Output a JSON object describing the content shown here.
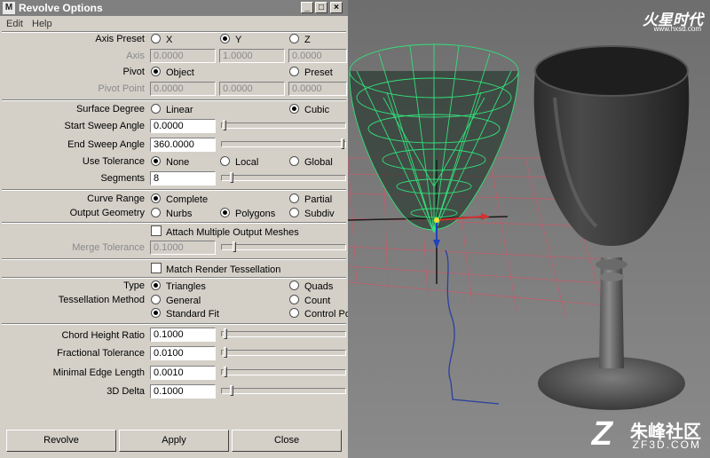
{
  "window": {
    "title": "Revolve Options",
    "min": "_",
    "max": "□",
    "close": "×"
  },
  "menu": [
    "Edit",
    "Help"
  ],
  "axis_preset": {
    "label": "Axis Preset",
    "options": [
      "X",
      "Y",
      "Z"
    ],
    "selected": "Y"
  },
  "axis": {
    "label": "Axis",
    "values": [
      "0.0000",
      "1.0000",
      "0.0000"
    ]
  },
  "pivot": {
    "label": "Pivot",
    "options": [
      "Object",
      "Preset"
    ],
    "selected": "Object"
  },
  "pivot_point": {
    "label": "Pivot Point",
    "values": [
      "0.0000",
      "0.0000",
      "0.0000"
    ]
  },
  "surface_degree": {
    "label": "Surface Degree",
    "options": [
      "Linear",
      "Cubic"
    ],
    "selected": "Cubic"
  },
  "start_sweep": {
    "label": "Start Sweep Angle",
    "value": "0.0000",
    "slider_fraction": 0.0
  },
  "end_sweep": {
    "label": "End Sweep Angle",
    "value": "360.0000",
    "slider_fraction": 1.0
  },
  "use_tolerance": {
    "label": "Use Tolerance",
    "options": [
      "None",
      "Local",
      "Global"
    ],
    "selected": "None"
  },
  "segments": {
    "label": "Segments",
    "value": "8",
    "slider_fraction": 0.06
  },
  "curve_range": {
    "label": "Curve Range",
    "options": [
      "Complete",
      "Partial"
    ],
    "selected": "Complete"
  },
  "output_geometry": {
    "label": "Output Geometry",
    "options": [
      "Nurbs",
      "Polygons",
      "Subdiv"
    ],
    "selected": "Polygons"
  },
  "attach_multiple": {
    "label": "Attach Multiple Output Meshes",
    "checked": false
  },
  "merge_tolerance": {
    "label": "Merge Tolerance",
    "value": "0.1000",
    "slider_fraction": 0.08
  },
  "match_render": {
    "label": "Match Render Tessellation",
    "checked": false
  },
  "type": {
    "label": "Type",
    "options": [
      "Triangles",
      "Quads"
    ],
    "selected": "Triangles"
  },
  "tessellation_method": {
    "label": "Tessellation Method",
    "options": [
      "General",
      "Count",
      "Standard Fit",
      "Control Poi"
    ],
    "selected": "Standard Fit"
  },
  "chord_height_ratio": {
    "label": "Chord Height Ratio",
    "value": "0.1000",
    "slider_fraction": 0.01
  },
  "fractional_tolerance": {
    "label": "Fractional Tolerance",
    "value": "0.0100",
    "slider_fraction": 0.01
  },
  "minimal_edge_length": {
    "label": "Minimal Edge Length",
    "value": "0.0010",
    "slider_fraction": 0.01
  },
  "delta_3d": {
    "label": "3D Delta",
    "value": "0.1000",
    "slider_fraction": 0.06
  },
  "buttons": {
    "revolve": "Revolve",
    "apply": "Apply",
    "close": "Close"
  },
  "watermarks": {
    "top_logo": "火星时代",
    "top_url": "www.hxsd.com",
    "bottom_brand": "朱峰社区",
    "bottom_url": "ZF3D.COM"
  },
  "colors": {
    "wireframe": "#33e07a",
    "grid_line": "#c85a6a",
    "curve": "#2a3fa0"
  }
}
